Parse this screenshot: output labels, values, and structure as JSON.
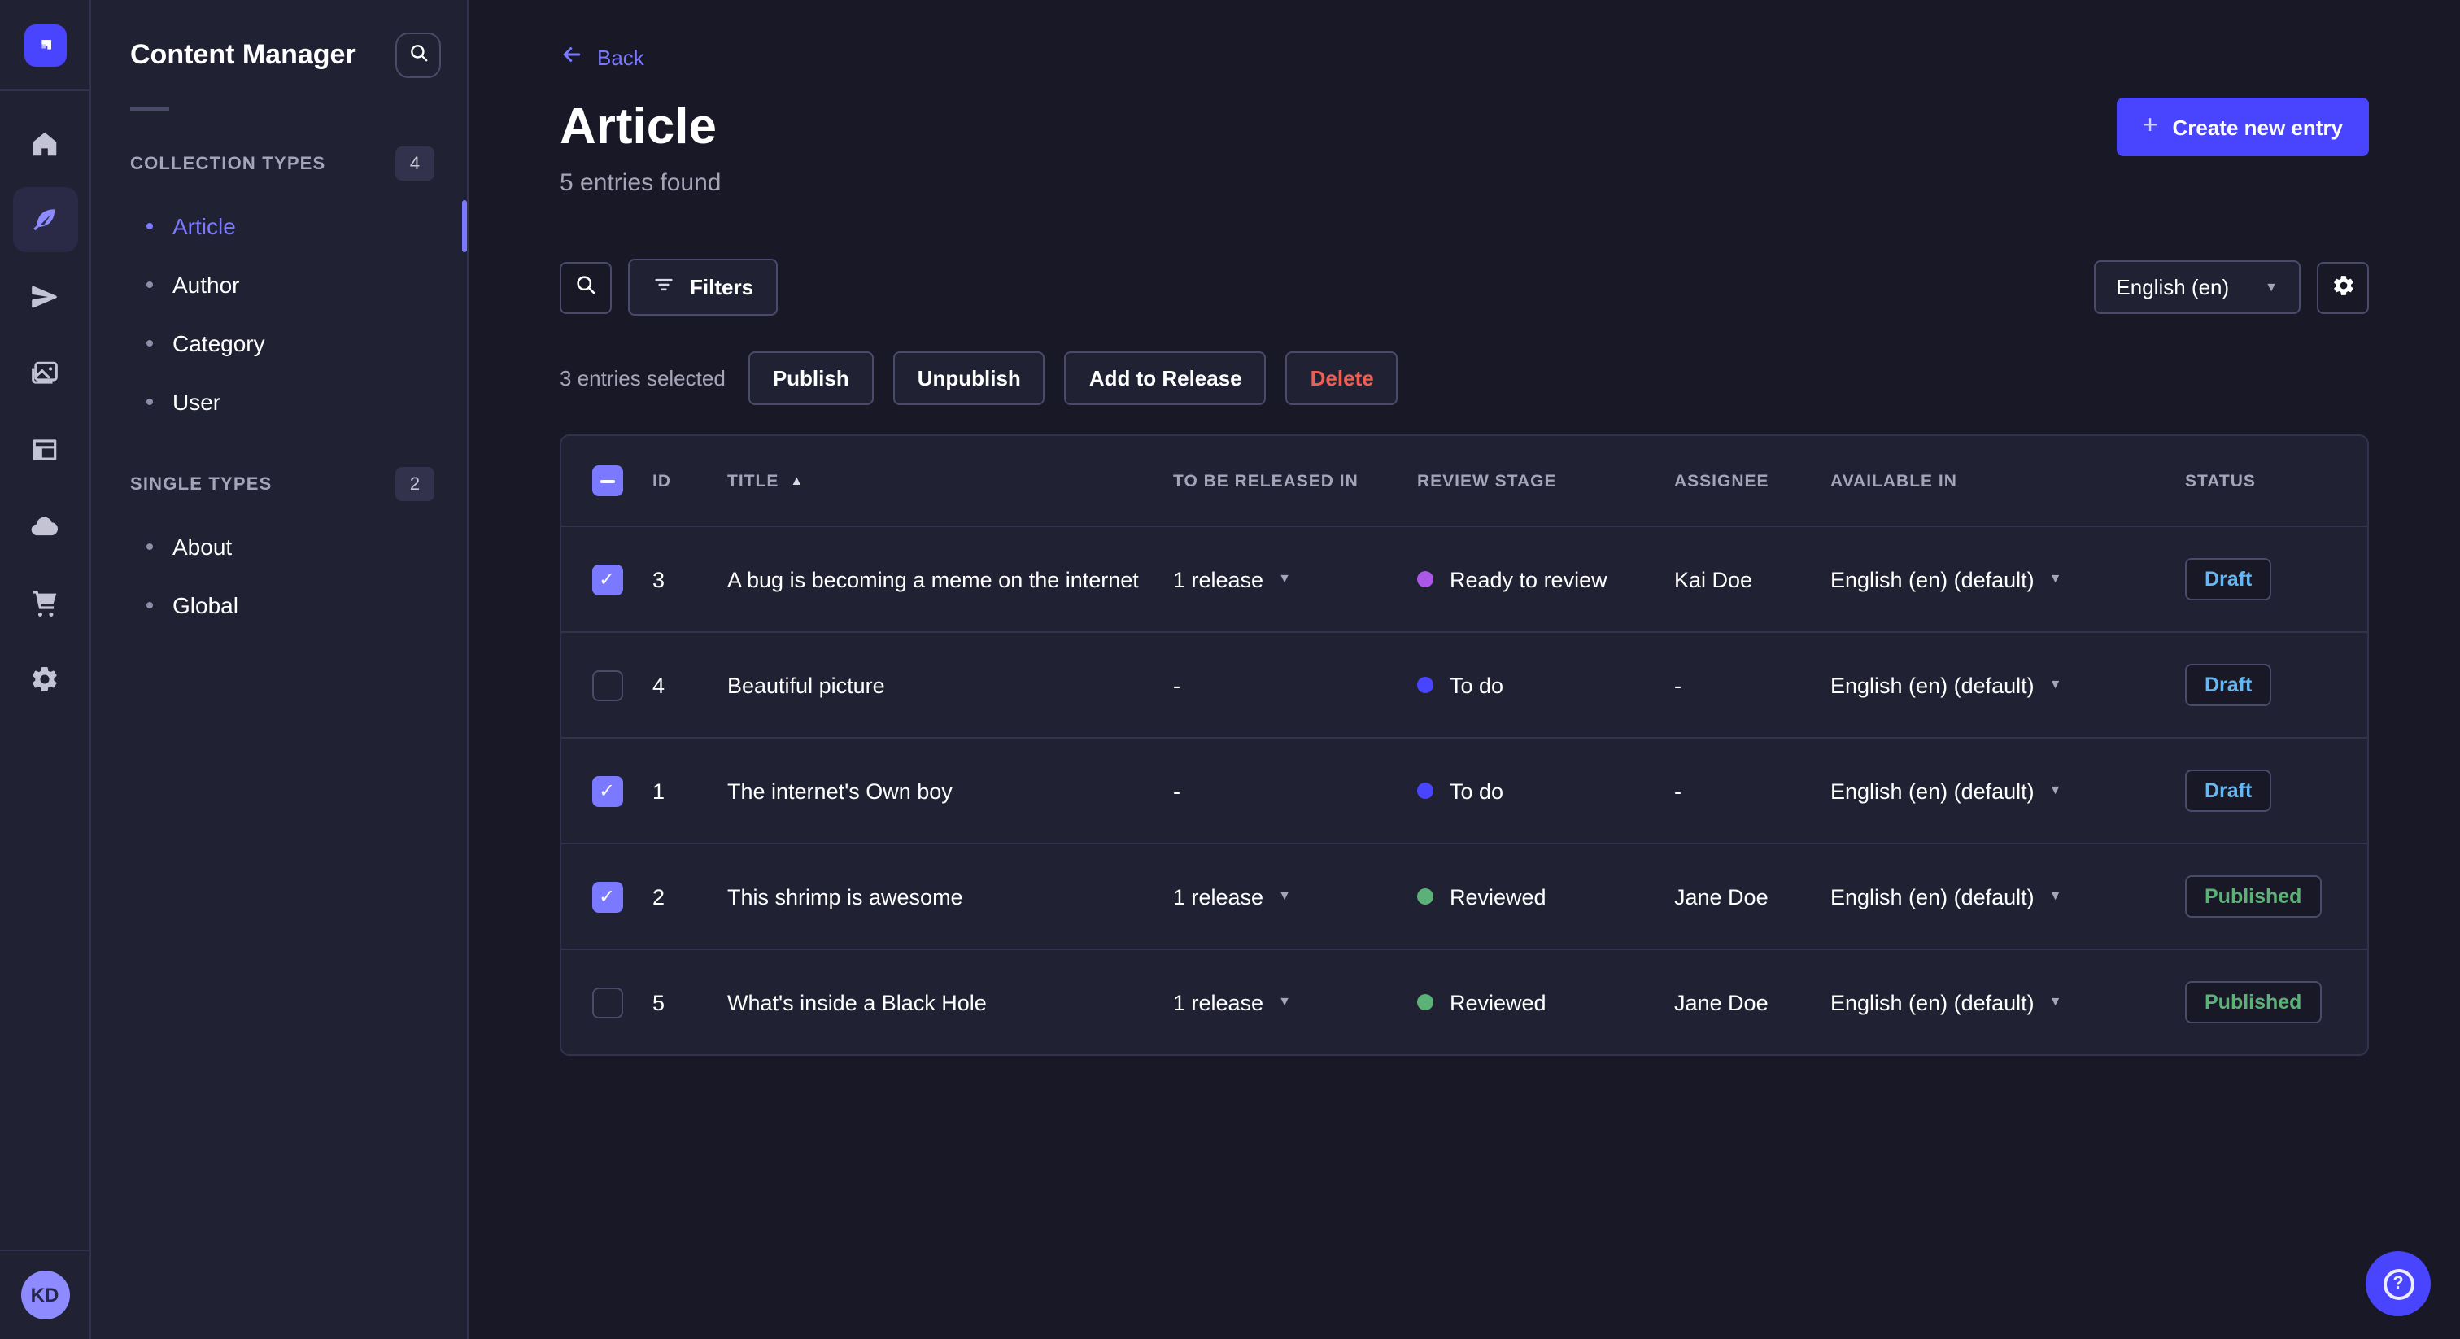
{
  "colors": {
    "primary": "#4945ff",
    "primary_light": "#7b79ff",
    "page_bg": "#181826",
    "panel_bg": "#212134",
    "border": "#32324d",
    "text_muted": "#a5a5ba",
    "danger": "#ee5e52",
    "status_draft": "#66b7f1",
    "status_published": "#5cb176",
    "stage_ready_to_review": "#ac57e8",
    "stage_to_do": "#4945ff",
    "stage_reviewed": "#5cb176"
  },
  "rail": {
    "icons": [
      "strapi-logo",
      "home",
      "content-manager-feather",
      "releases-send",
      "media-library",
      "content-type-builder",
      "deploy-cloud",
      "marketplace-cart",
      "settings-gear"
    ],
    "active_icon": "content-manager-feather",
    "avatar_initials": "KD"
  },
  "subnav": {
    "title": "Content Manager",
    "sections": [
      {
        "label": "COLLECTION TYPES",
        "badge": "4",
        "items": [
          {
            "label": "Article",
            "active": true
          },
          {
            "label": "Author"
          },
          {
            "label": "Category"
          },
          {
            "label": "User"
          }
        ]
      },
      {
        "label": "SINGLE TYPES",
        "badge": "2",
        "items": [
          {
            "label": "About"
          },
          {
            "label": "Global"
          }
        ]
      }
    ]
  },
  "header": {
    "back_label": "Back",
    "title": "Article",
    "subtitle": "5 entries found",
    "create_label": "Create new entry"
  },
  "toolbar": {
    "filters_label": "Filters",
    "locale_value": "English (en)"
  },
  "selection": {
    "summary": "3 entries selected",
    "publish_label": "Publish",
    "unpublish_label": "Unpublish",
    "add_to_release_label": "Add to Release",
    "delete_label": "Delete"
  },
  "table": {
    "select_all_state": "indeterminate",
    "sort_column": "TITLE",
    "sort_direction": "ascending",
    "headers": {
      "id": "ID",
      "title": "TITLE",
      "release": "TO BE RELEASED IN",
      "stage": "REVIEW STAGE",
      "assignee": "ASSIGNEE",
      "available": "AVAILABLE IN",
      "status": "STATUS"
    },
    "rows": [
      {
        "checkbox": "checked",
        "id": "3",
        "title": "A bug is becoming a meme on the internet",
        "release": "1 release",
        "stage": "Ready to review",
        "stage_color": "#ac57e8",
        "assignee": "Kai Doe",
        "available": "English (en) (default)",
        "status": "Draft",
        "status_color": "#66b7f1"
      },
      {
        "checkbox": "unchecked",
        "id": "4",
        "title": "Beautiful picture",
        "release": "-",
        "stage": "To do",
        "stage_color": "#4945ff",
        "assignee": "-",
        "available": "English (en) (default)",
        "status": "Draft",
        "status_color": "#66b7f1"
      },
      {
        "checkbox": "checked",
        "id": "1",
        "title": "The internet's Own boy",
        "release": "-",
        "stage": "To do",
        "stage_color": "#4945ff",
        "assignee": "-",
        "available": "English (en) (default)",
        "status": "Draft",
        "status_color": "#66b7f1"
      },
      {
        "checkbox": "checked",
        "id": "2",
        "title": "This shrimp is awesome",
        "release": "1 release",
        "stage": "Reviewed",
        "stage_color": "#5cb176",
        "assignee": "Jane Doe",
        "available": "English (en) (default)",
        "status": "Published",
        "status_color": "#5cb176"
      },
      {
        "checkbox": "unchecked",
        "id": "5",
        "title": "What's inside a Black Hole",
        "release": "1 release",
        "stage": "Reviewed",
        "stage_color": "#5cb176",
        "assignee": "Jane Doe",
        "available": "English (en) (default)",
        "status": "Published",
        "status_color": "#5cb176"
      }
    ]
  }
}
